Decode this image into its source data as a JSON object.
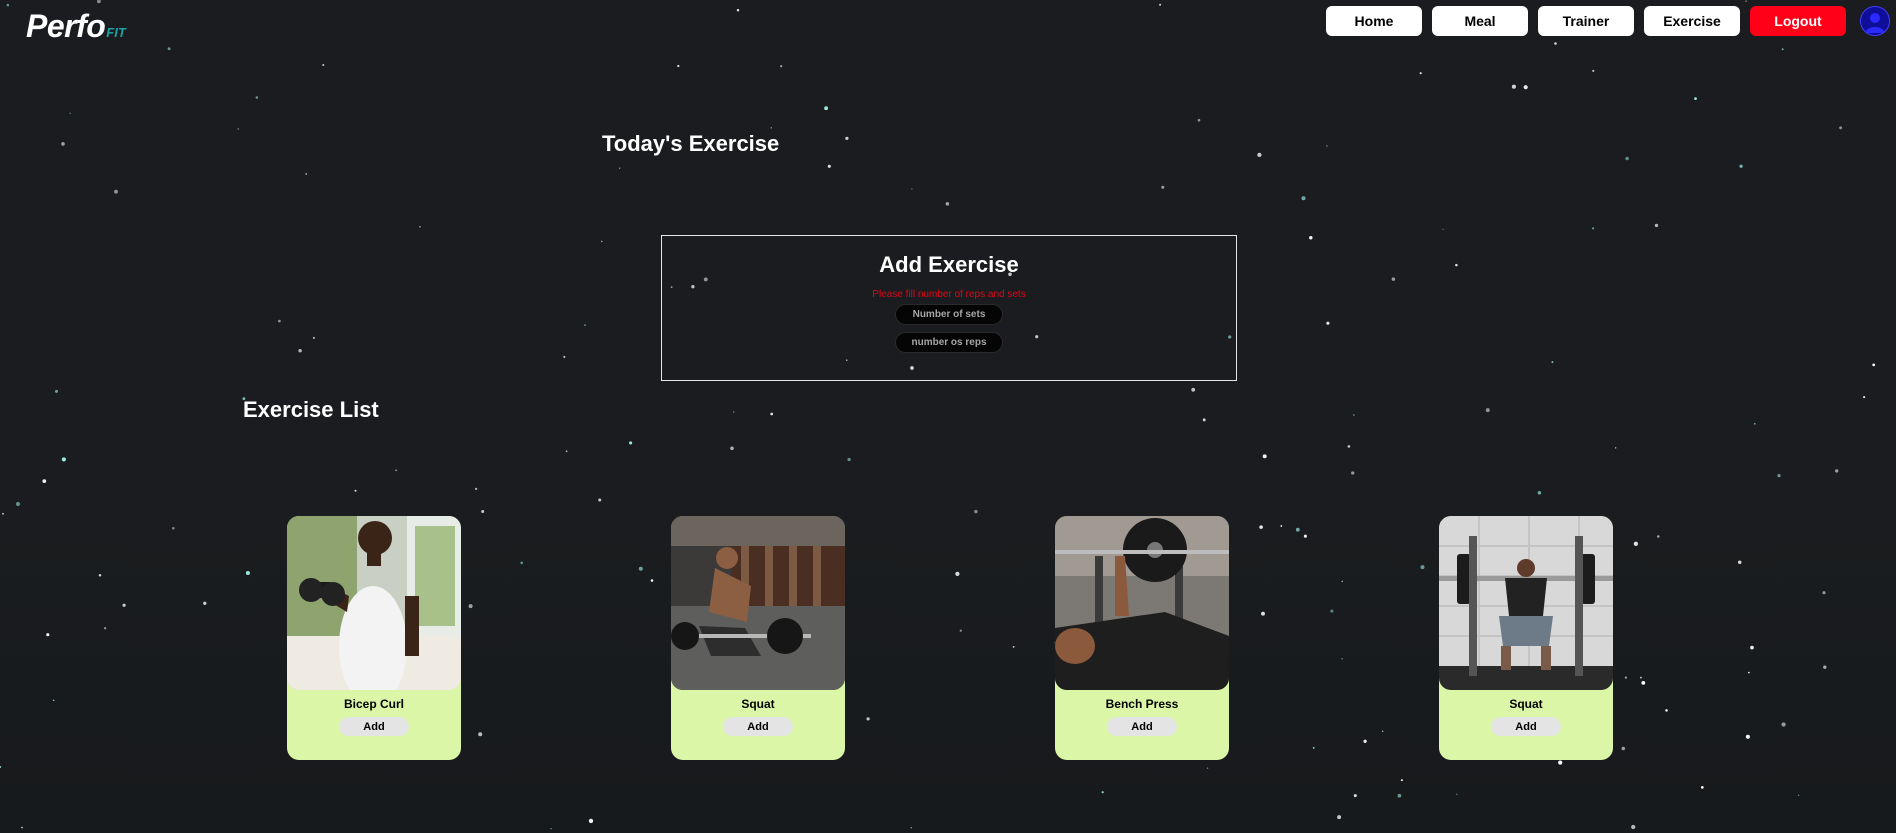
{
  "header": {
    "logo_main": "Perfo",
    "logo_sub": "FIT",
    "nav": [
      {
        "label": "Home"
      },
      {
        "label": "Meal"
      },
      {
        "label": "Trainer"
      },
      {
        "label": "Exercise"
      },
      {
        "label": "Logout"
      }
    ]
  },
  "today": {
    "title": "Today's Exercise"
  },
  "add_exercise": {
    "title": "Add Exercise",
    "warning": "Please fill number of reps and sets",
    "sets_placeholder": "Number of sets",
    "reps_placeholder": "number os reps"
  },
  "exercise_list": {
    "title": "Exercise List",
    "cards": [
      {
        "name": "Bicep Curl",
        "button": "Add"
      },
      {
        "name": "Squat",
        "button": "Add"
      },
      {
        "name": "Bench Press",
        "button": "Add"
      },
      {
        "name": "Squat",
        "button": "Add"
      }
    ]
  },
  "colors": {
    "background": "#1b1c1f",
    "card": "#daf6a6",
    "logout": "#ff0018",
    "warning": "#e0061a",
    "logo_accent": "#1aa3a3",
    "avatar": "#0e0e99"
  }
}
